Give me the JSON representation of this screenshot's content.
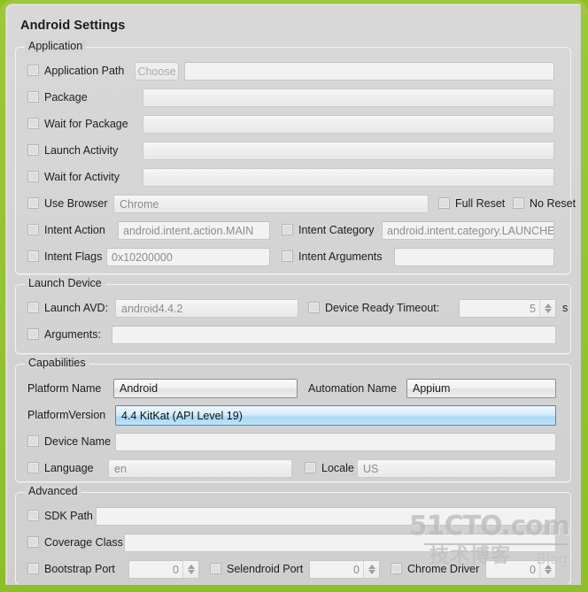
{
  "window": {
    "title": "Android Settings",
    "frame_color": "#8cc024",
    "surface_color": "#d4d4d4",
    "highlight_color": "#3c8fc4"
  },
  "groups": {
    "application": {
      "title": "Application",
      "rows": {
        "application_path": {
          "label": "Application Path",
          "button": "Choose",
          "value": ""
        },
        "package": {
          "label": "Package",
          "value": ""
        },
        "wait_for_package": {
          "label": "Wait for Package",
          "value": ""
        },
        "launch_activity": {
          "label": "Launch Activity",
          "value": ""
        },
        "wait_for_activity": {
          "label": "Wait for Activity",
          "value": ""
        },
        "use_browser": {
          "label": "Use Browser",
          "value": "Chrome"
        },
        "full_reset": {
          "label": "Full Reset"
        },
        "no_reset": {
          "label": "No Reset"
        },
        "intent_action": {
          "label": "Intent Action",
          "value": "android.intent.action.MAIN"
        },
        "intent_category": {
          "label": "Intent Category",
          "value": "android.intent.category.LAUNCHER"
        },
        "intent_flags": {
          "label": "Intent Flags",
          "value": "0x10200000"
        },
        "intent_arguments": {
          "label": "Intent Arguments",
          "value": ""
        }
      }
    },
    "launch_device": {
      "title": "Launch Device",
      "rows": {
        "launch_avd": {
          "label": "Launch AVD:",
          "value": "android4.4.2"
        },
        "device_ready_timeout": {
          "label": "Device Ready Timeout:",
          "value": "5",
          "unit": "s"
        },
        "arguments": {
          "label": "Arguments:",
          "value": ""
        }
      }
    },
    "capabilities": {
      "title": "Capabilities",
      "rows": {
        "platform_name": {
          "label": "Platform Name",
          "value": "Android"
        },
        "automation_name": {
          "label": "Automation Name",
          "value": "Appium"
        },
        "platform_version": {
          "label": "PlatformVersion",
          "value": "4.4 KitKat (API Level 19)"
        },
        "device_name": {
          "label": "Device Name",
          "value": ""
        },
        "language": {
          "label": "Language",
          "value": "en"
        },
        "locale": {
          "label": "Locale",
          "value": "US"
        }
      }
    },
    "advanced": {
      "title": "Advanced",
      "rows": {
        "sdk_path": {
          "label": "SDK Path",
          "value": ""
        },
        "coverage_class": {
          "label": "Coverage Class",
          "value": ""
        },
        "bootstrap_port": {
          "label": "Bootstrap Port",
          "value": "0"
        },
        "selendroid_port": {
          "label": "Selendroid Port",
          "value": "0"
        },
        "chrome_driver_port": {
          "label": "Chrome Driver",
          "value": "0"
        }
      }
    }
  },
  "watermark": {
    "site": "51CTO.com",
    "chinese": "技术博客",
    "blog": "Blog"
  }
}
